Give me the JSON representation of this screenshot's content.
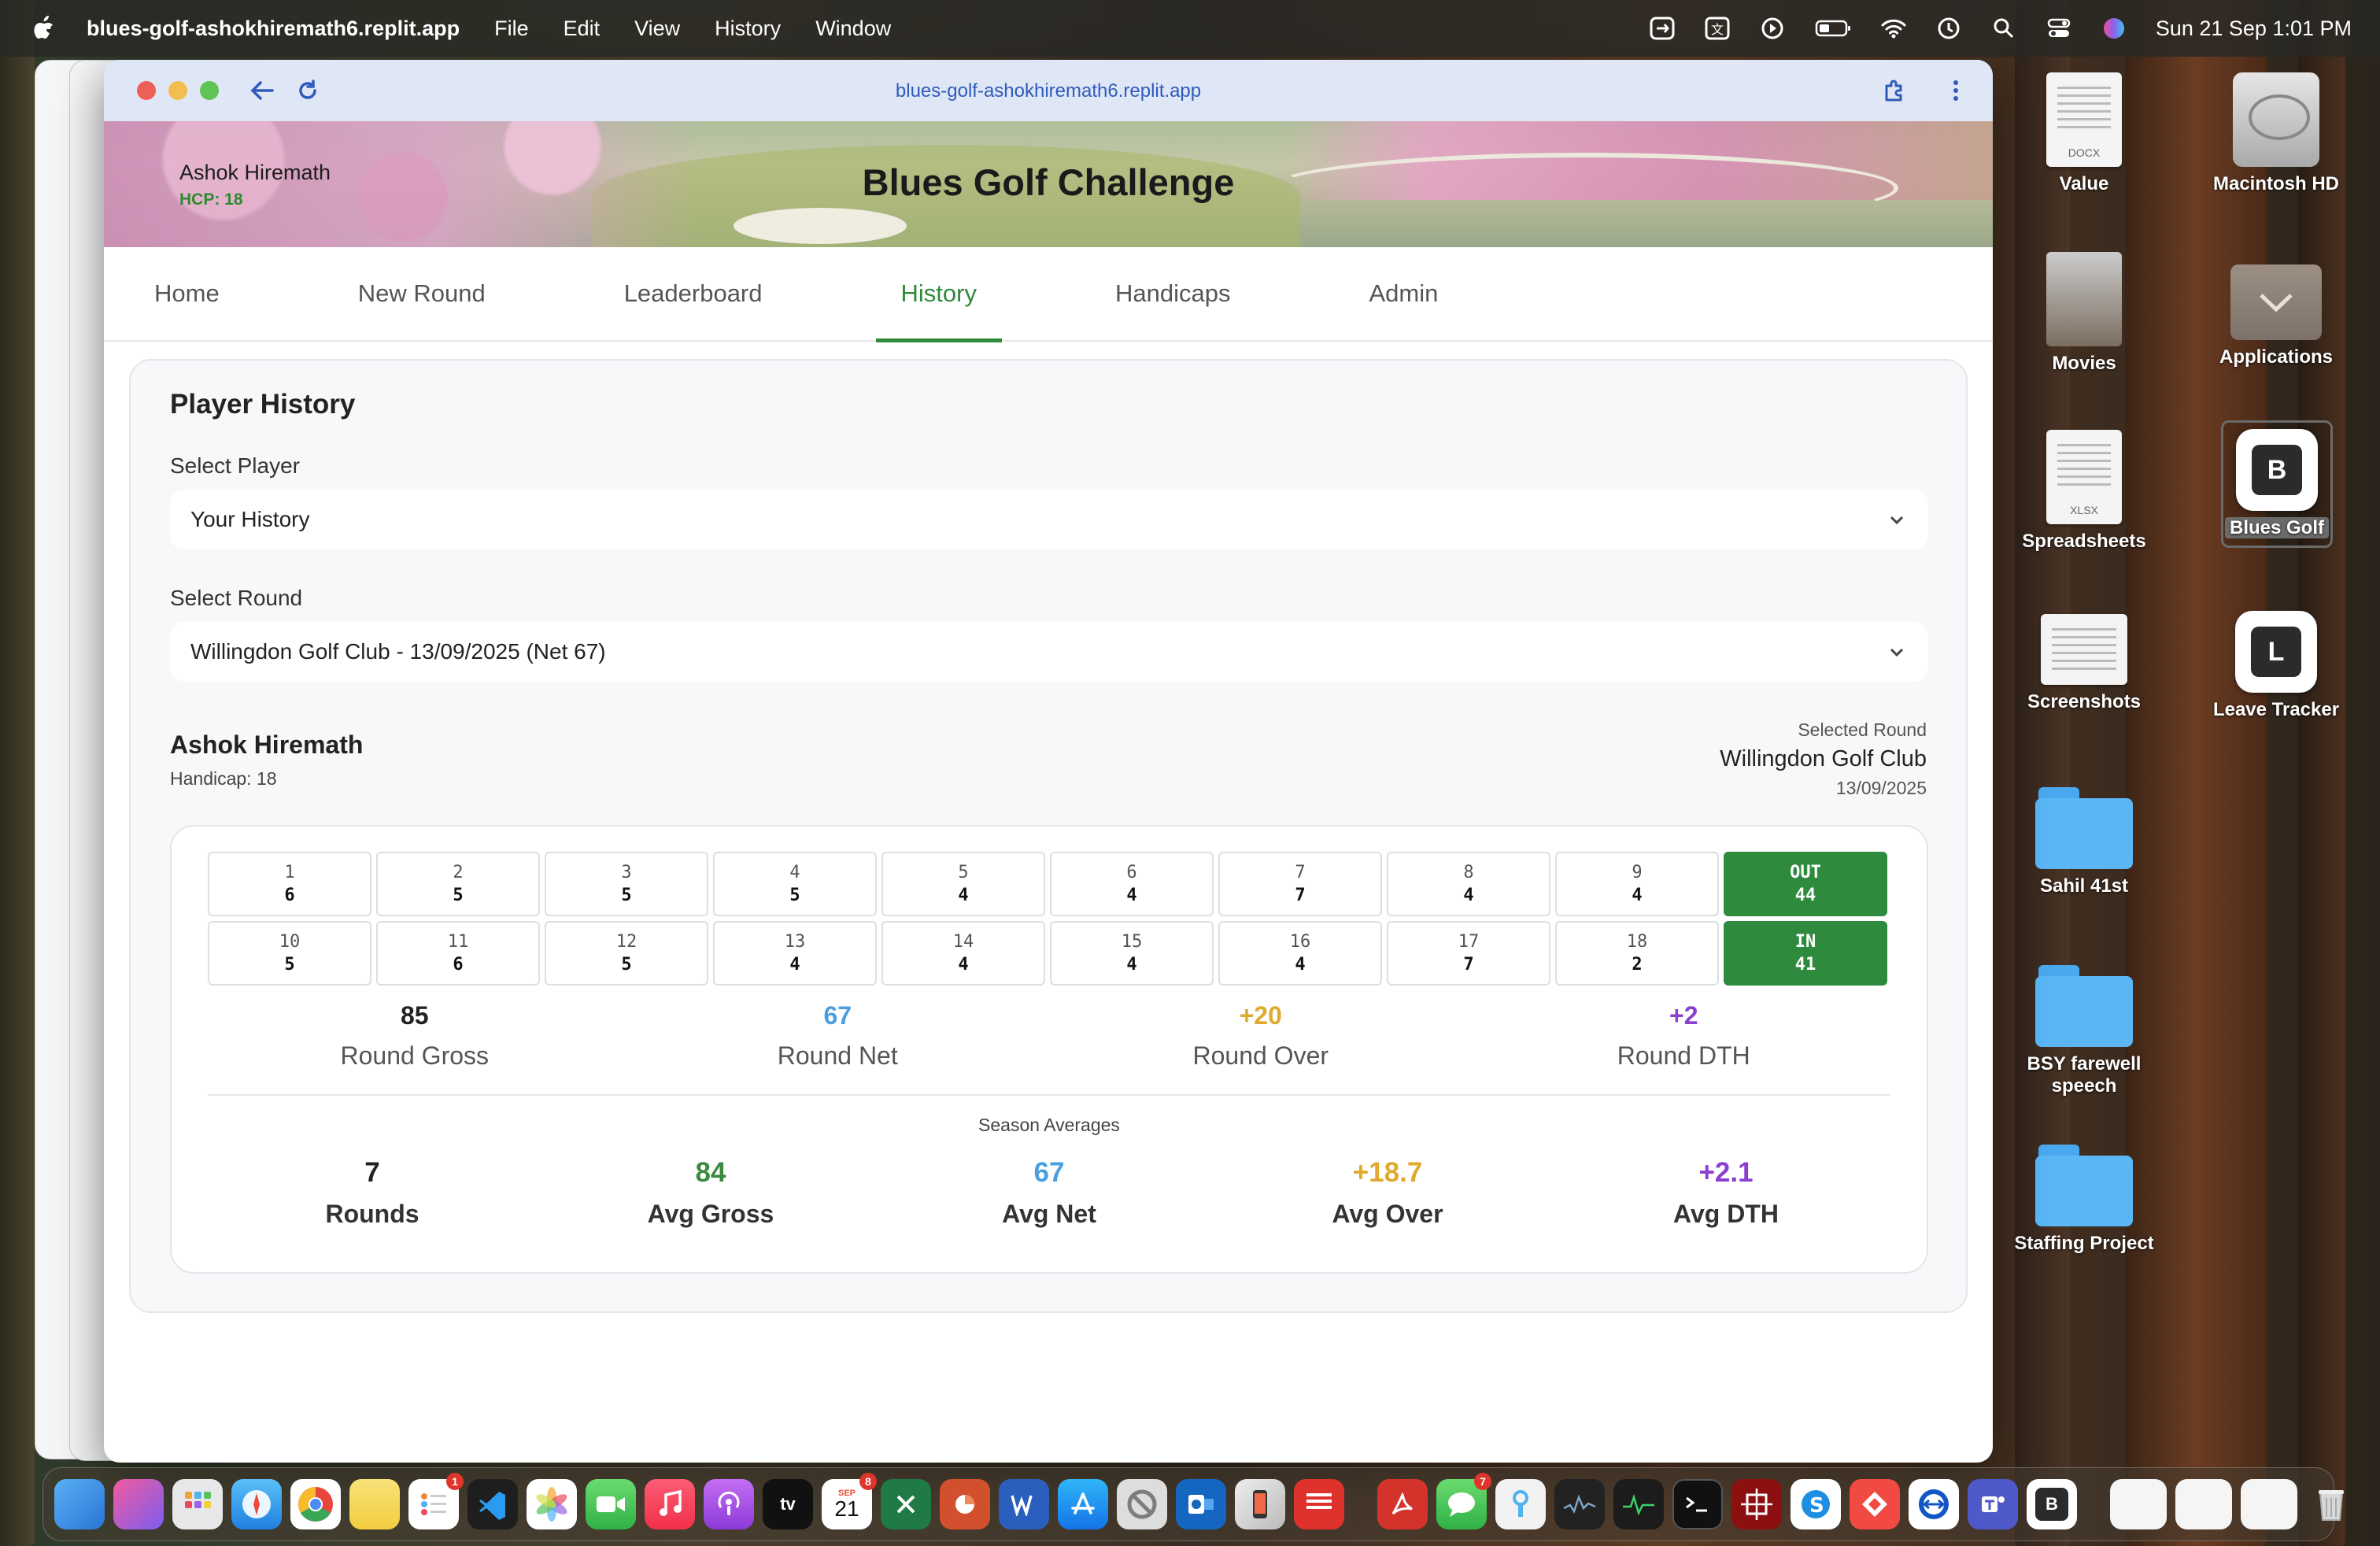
{
  "menubar": {
    "app_name": "blues-golf-ashokhiremath6.replit.app",
    "menus": [
      "File",
      "Edit",
      "View",
      "History",
      "Window"
    ],
    "clock": "Sun 21 Sep  1:01 PM"
  },
  "browser": {
    "url": "blues-golf-ashokhiremath6.replit.app"
  },
  "header": {
    "user_name": "Ashok Hiremath",
    "user_hcp": "HCP: 18",
    "title": "Blues Golf Challenge"
  },
  "tabs": [
    {
      "label": "Home"
    },
    {
      "label": "New Round"
    },
    {
      "label": "Leaderboard"
    },
    {
      "label": "History"
    },
    {
      "label": "Handicaps"
    },
    {
      "label": "Admin"
    }
  ],
  "history": {
    "title": "Player History",
    "select_player_label": "Select Player",
    "select_player_value": "Your History",
    "select_round_label": "Select Round",
    "select_round_value": "Willingdon Golf Club - 13/09/2025 (Net 67)",
    "player_name": "Ashok Hiremath",
    "player_handicap": "Handicap: 18",
    "selected_round_label": "Selected Round",
    "selected_course": "Willingdon Golf Club",
    "selected_date": "13/09/2025",
    "front_nine": [
      {
        "hole": "1",
        "score": "6"
      },
      {
        "hole": "2",
        "score": "5"
      },
      {
        "hole": "3",
        "score": "5"
      },
      {
        "hole": "4",
        "score": "5"
      },
      {
        "hole": "5",
        "score": "4"
      },
      {
        "hole": "6",
        "score": "4"
      },
      {
        "hole": "7",
        "score": "7"
      },
      {
        "hole": "8",
        "score": "4"
      },
      {
        "hole": "9",
        "score": "4"
      }
    ],
    "out_total": {
      "label": "OUT",
      "score": "44"
    },
    "back_nine": [
      {
        "hole": "10",
        "score": "5"
      },
      {
        "hole": "11",
        "score": "6"
      },
      {
        "hole": "12",
        "score": "5"
      },
      {
        "hole": "13",
        "score": "4"
      },
      {
        "hole": "14",
        "score": "4"
      },
      {
        "hole": "15",
        "score": "4"
      },
      {
        "hole": "16",
        "score": "4"
      },
      {
        "hole": "17",
        "score": "7"
      },
      {
        "hole": "18",
        "score": "2"
      }
    ],
    "in_total": {
      "label": "IN",
      "score": "41"
    },
    "round_stats": [
      {
        "value": "85",
        "label": "Round Gross",
        "color": "#222222"
      },
      {
        "value": "67",
        "label": "Round Net",
        "color": "#4a9fe0"
      },
      {
        "value": "+20",
        "label": "Round Over",
        "color": "#e0a92f"
      },
      {
        "value": "+2",
        "label": "Round DTH",
        "color": "#8a3fd1"
      }
    ],
    "season_label": "Season Averages",
    "season_stats": [
      {
        "value": "7",
        "label": "Rounds",
        "color": "#222222"
      },
      {
        "value": "84",
        "label": "Avg Gross",
        "color": "#3a8a3f"
      },
      {
        "value": "67",
        "label": "Avg Net",
        "color": "#4a9fe0"
      },
      {
        "value": "+18.7",
        "label": "Avg Over",
        "color": "#e0a92f"
      },
      {
        "value": "+2.1",
        "label": "Avg DTH",
        "color": "#8a3fd1"
      }
    ]
  },
  "desktop": {
    "value": "Value",
    "value_tag": "DOCX",
    "macintosh_hd": "Macintosh HD",
    "movies": "Movies",
    "applications": "Applications",
    "spreadsheets": "Spreadsheets",
    "spreadsheets_tag": "XLSX",
    "blues_golf": "Blues Golf",
    "blues_golf_letter": "B",
    "screenshots": "Screenshots",
    "leave_tracker": "Leave Tracker",
    "leave_tracker_letter": "L",
    "sahil": "Sahil 41st",
    "bsy": "BSY farewell speech",
    "staffing": "Staffing Project"
  },
  "dock": {
    "badges": {
      "reminders": "1",
      "calendar": "8",
      "messages": "7"
    },
    "calendar_day": "21",
    "calendar_month": "SEP",
    "tv_label": "tv",
    "blues_letter": "B"
  },
  "colors": {
    "accent_green": "#2f8a3a",
    "total_green": "#2e8b3e"
  }
}
